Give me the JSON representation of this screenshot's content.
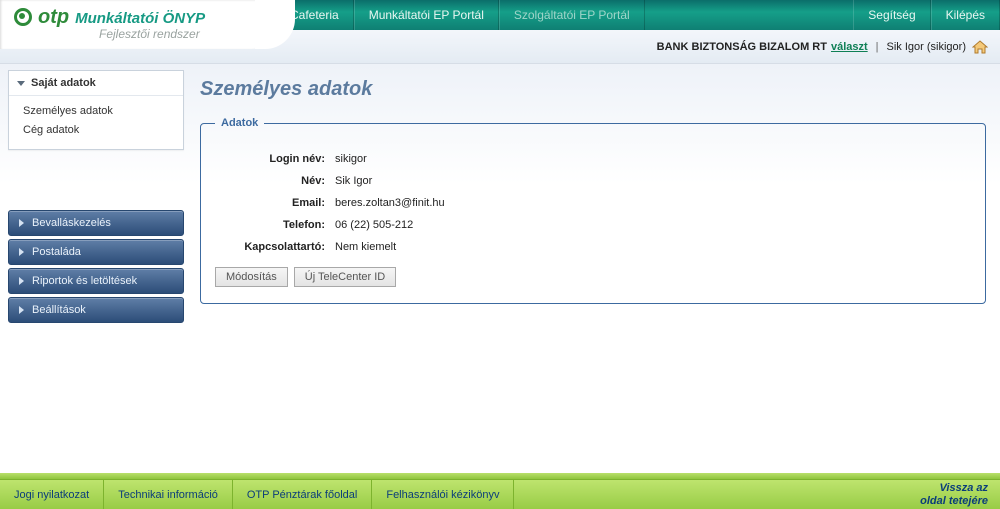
{
  "brand": {
    "name": "otp",
    "product": "Munkáltatói ÖNYP",
    "subtitle": "Fejlesztői rendszer"
  },
  "topnav": {
    "left": [
      {
        "label": "Cafeteria"
      },
      {
        "label": "Munkáltatói EP Portál"
      },
      {
        "label": "Szolgáltatói EP Portál",
        "dim": true
      }
    ],
    "right": [
      {
        "label": "Segítség"
      },
      {
        "label": "Kilépés"
      }
    ]
  },
  "subheader": {
    "company": "BANK BIZTONSÁG BIZALOM RT",
    "choose_link": "választ",
    "user_display": "Sik Igor (sikigor)"
  },
  "sidebar": {
    "active_panel_title": "Saját adatok",
    "active_panel_items": [
      {
        "label": "Személyes adatok"
      },
      {
        "label": "Cég adatok"
      }
    ],
    "menus": [
      {
        "label": "Bevalláskezelés"
      },
      {
        "label": "Postaláda"
      },
      {
        "label": "Riportok és letöltések"
      },
      {
        "label": "Beállítások"
      }
    ]
  },
  "page": {
    "title": "Személyes adatok",
    "fieldset_legend": "Adatok",
    "labels": {
      "login": "Login név:",
      "name": "Név:",
      "email": "Email:",
      "phone": "Telefon:",
      "contact": "Kapcsolattartó:"
    },
    "values": {
      "login": "sikigor",
      "name": "Sik Igor",
      "email": "beres.zoltan3@finit.hu",
      "phone": "06 (22) 505-212",
      "contact": "Nem kiemelt"
    },
    "buttons": {
      "modify": "Módosítás",
      "new_tc": "Új TeleCenter ID"
    }
  },
  "footer": {
    "links": [
      {
        "label": "Jogi nyilatkozat"
      },
      {
        "label": "Technikai információ"
      },
      {
        "label": "OTP Pénztárak főoldal"
      },
      {
        "label": "Felhasználói kézikönyv"
      }
    ],
    "back_to_top_l1": "Vissza az",
    "back_to_top_l2": "oldal tetejére"
  }
}
